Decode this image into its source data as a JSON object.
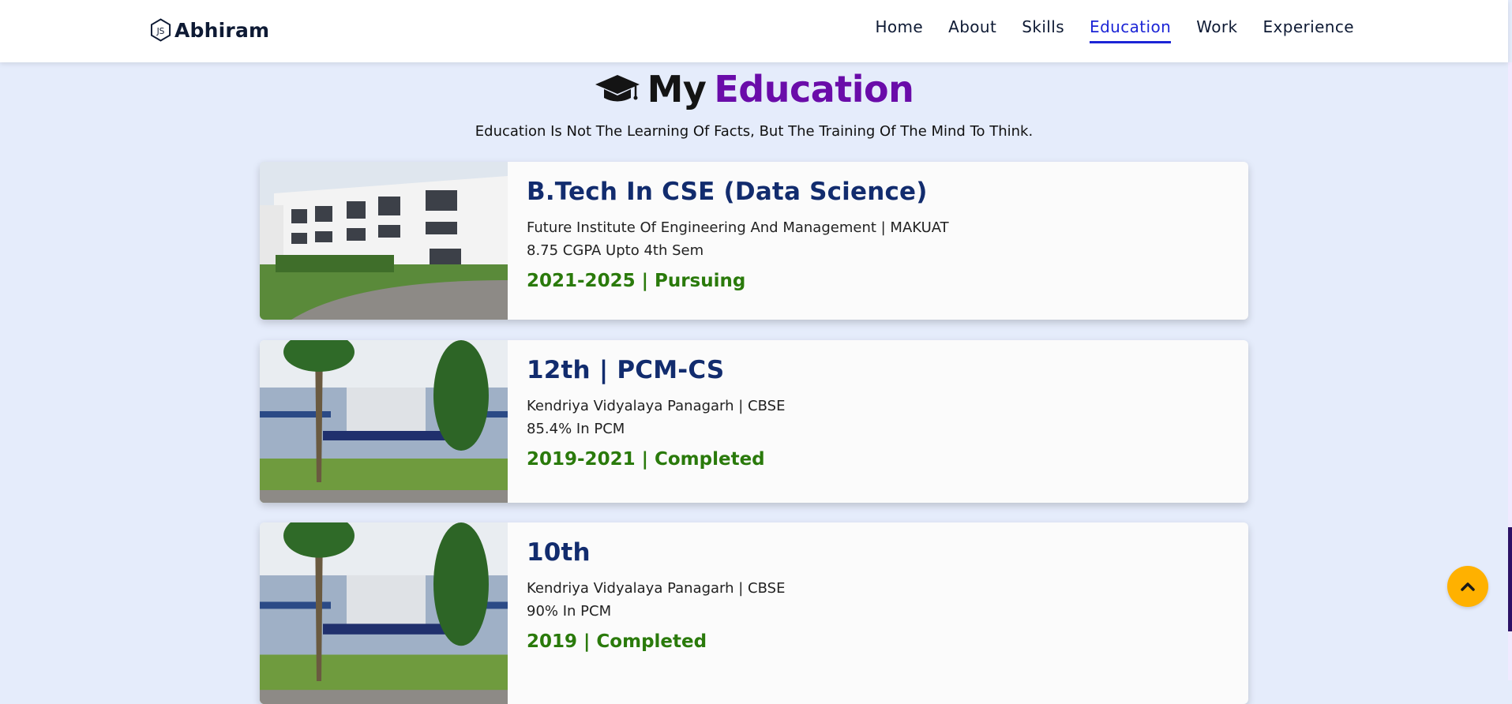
{
  "header": {
    "brand": "Abhiram",
    "nav": [
      {
        "label": "Home"
      },
      {
        "label": "About"
      },
      {
        "label": "Skills"
      },
      {
        "label": "Education"
      },
      {
        "label": "Work"
      },
      {
        "label": "Experience"
      }
    ],
    "active_index": 3
  },
  "section": {
    "title_part1": "My",
    "title_part2": "Education",
    "quote": "Education Is Not The Learning Of Facts, But The Training Of The Mind To Think."
  },
  "cards": [
    {
      "title": "B.Tech In CSE (Data Science)",
      "institution": "Future Institute Of Engineering And Management | MAKUAT",
      "score": "8.75 CGPA Upto 4th Sem",
      "status": "2021-2025 | Pursuing"
    },
    {
      "title": "12th | PCM-CS",
      "institution": "Kendriya Vidyalaya Panagarh | CBSE",
      "score": "85.4% In PCM",
      "status": "2019-2021 | Completed"
    },
    {
      "title": "10th",
      "institution": "Kendriya Vidyalaya Panagarh | CBSE",
      "score": "90% In PCM",
      "status": "2019 | Completed"
    }
  ],
  "icons": {
    "brand": "nodejs-hexagon-icon",
    "heading": "graduation-cap-icon",
    "scroll_top": "chevron-up-icon"
  },
  "colors": {
    "accent": "#6a0ca9",
    "nav_active": "#1c25d6",
    "status_green": "#2a7a0b",
    "title_blue": "#122c6e",
    "scroll_button": "#ffb100"
  }
}
